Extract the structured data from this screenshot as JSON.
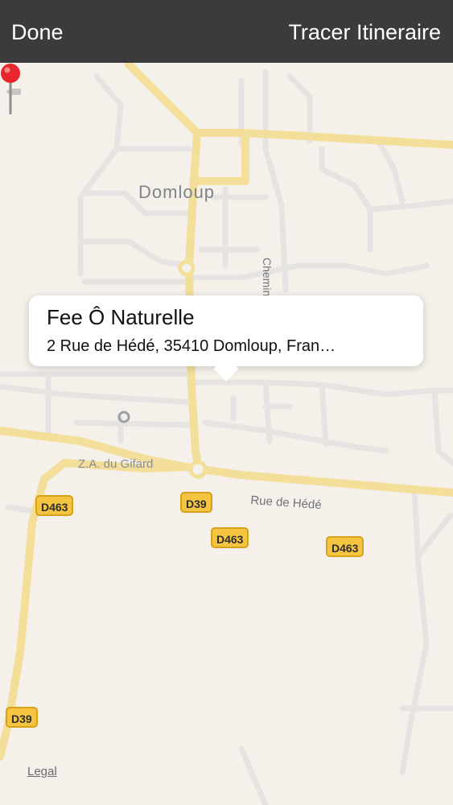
{
  "toolbar": {
    "done_label": "Done",
    "route_label": "Tracer Itineraire"
  },
  "map": {
    "town_label": "Domloup",
    "zone_label": "Z.A. du Gifard",
    "street_label": "Rue de Hédé",
    "path_label": "Chemin Piéton",
    "road_shields": [
      "D463",
      "D39",
      "D463",
      "D463",
      "D39"
    ],
    "legal_label": "Legal",
    "colors": {
      "background": "#f5f0ea",
      "major_road": "#f3df9a",
      "minor_road": "#e6e4e2",
      "shield": "#f5c542",
      "pin": "#e8262b"
    }
  },
  "callout": {
    "title": "Fee Ô Naturelle",
    "address": "2 Rue de Hédé, 35410 Domloup, Fran…"
  },
  "pin": {
    "icon": "map-pin-icon"
  }
}
